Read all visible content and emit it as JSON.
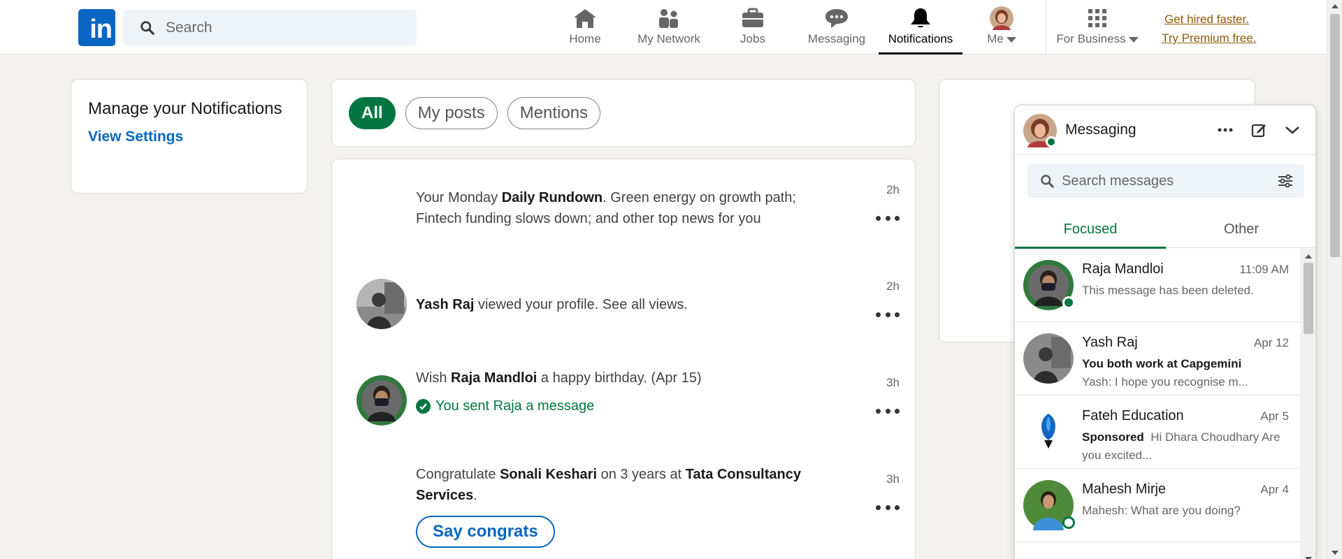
{
  "header": {
    "logo_text": "in",
    "search_placeholder": "Search",
    "nav": [
      {
        "label": "Home",
        "icon": "home-icon"
      },
      {
        "label": "My Network",
        "icon": "network-icon"
      },
      {
        "label": "Jobs",
        "icon": "briefcase-icon"
      },
      {
        "label": "Messaging",
        "icon": "chat-icon"
      },
      {
        "label": "Notifications",
        "icon": "bell-icon"
      },
      {
        "label": "Me",
        "icon": "avatar"
      },
      {
        "label": "For Business",
        "icon": "grid-icon"
      }
    ],
    "premium_line1": "Get hired faster.",
    "premium_line2": "Try Premium free."
  },
  "manage": {
    "title": "Manage your Notifications",
    "link": "View Settings"
  },
  "filters": [
    "All",
    "My posts",
    "Mentions"
  ],
  "notifications": [
    {
      "pre": "Your Monday ",
      "bold": "Daily Rundown",
      "post": ". Green energy on growth path; Fintech funding slows down; and other top news for you",
      "time": "2h"
    },
    {
      "bold": "Yash Raj",
      "post": " viewed your profile. See all views.",
      "time": "2h"
    },
    {
      "pre": "Wish ",
      "bold": "Raja Mandloi",
      "post": " a happy birthday. (Apr 15)",
      "sent": "You sent Raja a message",
      "time": "3h"
    },
    {
      "pre": "Congratulate ",
      "bold": "Sonali Keshari",
      "mid": " on 3 years at ",
      "bold2": "Tata Consultancy Services",
      "post": ".",
      "button": "Say congrats",
      "time": "3h"
    }
  ],
  "messaging": {
    "title": "Messaging",
    "search_placeholder": "Search messages",
    "tabs": [
      "Focused",
      "Other"
    ],
    "conversations": [
      {
        "name": "Raja Mandloi",
        "date": "11:09 AM",
        "line": "This message has been deleted."
      },
      {
        "name": "Yash Raj",
        "date": "Apr 12",
        "bold": "You both work at Capgemini",
        "line": "Yash: I hope you recognise m..."
      },
      {
        "name": "Fateh Education",
        "date": "Apr 5",
        "bold": "Sponsored",
        "line": "Hi Dhara Choudhary Are you excited..."
      },
      {
        "name": "Mahesh Mirje",
        "date": "Apr 4",
        "line": "Mahesh: What are you doing?"
      }
    ]
  },
  "colors": {
    "brand_blue": "#0a66c2",
    "green": "#057642",
    "premium": "#915907",
    "background": "#f3f2ef"
  }
}
